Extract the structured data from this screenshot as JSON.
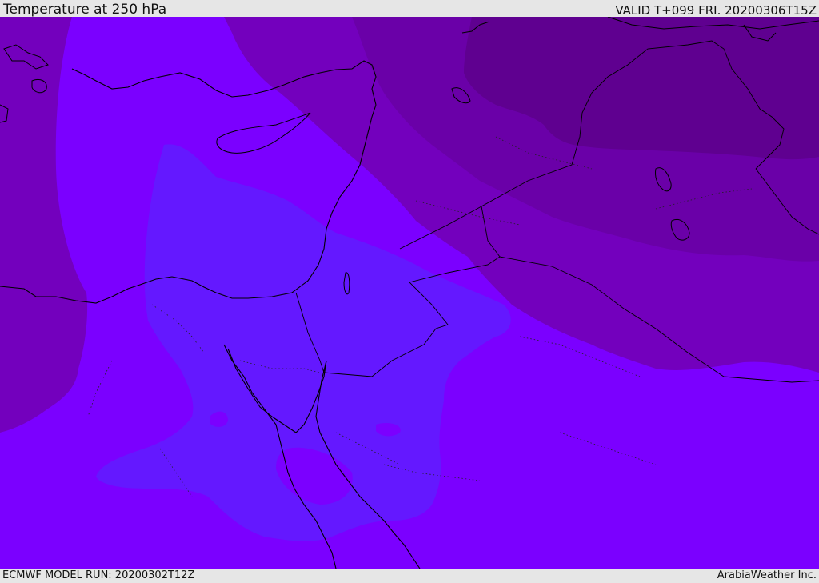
{
  "header": {
    "title": "Temperature at 250 hPa",
    "valid_time": "VALID T+099 FRI. 20200306T15Z"
  },
  "footer": {
    "model_run": "ECMWF MODEL RUN: 20200302T12Z",
    "credit": "ArabiaWeather Inc."
  },
  "map": {
    "variable": "temperature",
    "level": "250 hPa",
    "colors": {
      "background": "#7b00ff",
      "coldest": "#5f0090",
      "cold": "#6a00a8",
      "mid_dark": "#7300bd",
      "mid": "#7500d6",
      "warm_core": "#6418ff",
      "coast": "#000000"
    }
  }
}
